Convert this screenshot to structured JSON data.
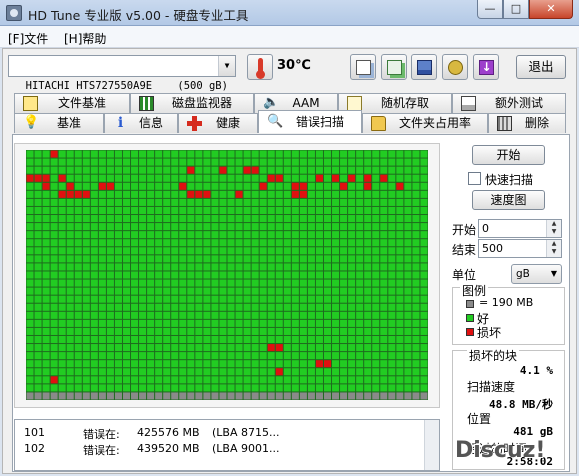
{
  "window": {
    "title": "HD Tune 专业版 v5.00 - 硬盘专业工具",
    "min": "—",
    "max": "□",
    "close": "✕"
  },
  "menu": {
    "file": "[F]文件",
    "help": "[H]帮助"
  },
  "drive": {
    "selected": "HITACHI HTS727550A9E    (500 gB)",
    "temperature": "30℃"
  },
  "toolbar": {
    "icons": [
      "copy-info-icon",
      "copy-screenshot-icon",
      "save-icon",
      "options-icon",
      "download-icon"
    ],
    "exit_label": "退出"
  },
  "tabs_top": [
    {
      "label": "文件基准",
      "icon": "file-benchmark-icon"
    },
    {
      "label": "磁盘监视器",
      "icon": "disk-monitor-icon"
    },
    {
      "label": "AAM",
      "icon": "speaker-icon"
    },
    {
      "label": "随机存取",
      "icon": "random-access-icon"
    },
    {
      "label": "额外测试",
      "icon": "extra-tests-icon"
    }
  ],
  "tabs_bottom": [
    {
      "label": "基准",
      "icon": "bulb-icon"
    },
    {
      "label": "信息",
      "icon": "info-icon"
    },
    {
      "label": "健康",
      "icon": "health-cross-icon"
    },
    {
      "label": "错误扫描",
      "icon": "magnifier-icon",
      "active": true
    },
    {
      "label": "文件夹占用率",
      "icon": "folder-icon"
    },
    {
      "label": "删除",
      "icon": "trash-icon"
    }
  ],
  "scan": {
    "start_button": "开始",
    "quick_scan_label": "快速扫描",
    "quick_scan_checked": false,
    "speed_map_button": "速度图",
    "start_label": "开始",
    "start_value": "0",
    "end_label": "结束",
    "end_value": "500",
    "unit_label": "单位",
    "unit_value": "gB"
  },
  "legend": {
    "title": "图例",
    "block_size": "= 190 MB",
    "good": "好",
    "bad": "损坏"
  },
  "stats": {
    "damaged_blocks_label": "损坏的块",
    "damaged_blocks_value": "4.1 %",
    "scan_speed_label": "扫描速度",
    "scan_speed_value": "48.8 MB/秒",
    "position_label": "位置",
    "position_value": "481 gB",
    "elapsed_label": "经过的时间",
    "elapsed_value": "2:58:02"
  },
  "log": [
    {
      "num": "101",
      "type": "错误在:",
      "pos": "425576 MB",
      "lba": "(LBA 8715..."
    },
    {
      "num": "102",
      "type": "错误在:",
      "pos": "439520 MB",
      "lba": "(LBA 9001..."
    }
  ],
  "grid_map": {
    "columns": 50,
    "rows": 31,
    "scanned_rows": 30,
    "colors": {
      "good": "#22cc22",
      "bad": "#e01010",
      "unscanned": "#8a8a8a",
      "grid_line": "#1e6b1e"
    },
    "bad_blocks": [
      [
        0,
        3
      ],
      [
        2,
        20
      ],
      [
        2,
        24
      ],
      [
        2,
        27
      ],
      [
        2,
        28
      ],
      [
        3,
        1
      ],
      [
        3,
        2
      ],
      [
        3,
        30
      ],
      [
        3,
        31
      ],
      [
        3,
        36
      ],
      [
        3,
        38
      ],
      [
        3,
        40
      ],
      [
        3,
        42
      ],
      [
        3,
        44
      ],
      [
        4,
        5
      ],
      [
        4,
        19
      ],
      [
        4,
        29
      ],
      [
        5,
        20
      ],
      [
        5,
        21
      ],
      [
        5,
        22
      ],
      [
        5,
        26
      ],
      [
        5,
        33
      ],
      [
        5,
        34
      ],
      [
        3,
        0
      ],
      [
        3,
        4
      ],
      [
        4,
        2
      ],
      [
        4,
        9
      ],
      [
        4,
        10
      ],
      [
        4,
        33
      ],
      [
        4,
        34
      ],
      [
        4,
        39
      ],
      [
        4,
        42
      ],
      [
        4,
        46
      ],
      [
        5,
        4
      ],
      [
        5,
        5
      ],
      [
        5,
        6
      ],
      [
        5,
        7
      ],
      [
        24,
        30
      ],
      [
        24,
        31
      ],
      [
        26,
        36
      ],
      [
        26,
        37
      ],
      [
        27,
        31
      ],
      [
        28,
        3
      ]
    ]
  },
  "watermark": "Discuz!"
}
